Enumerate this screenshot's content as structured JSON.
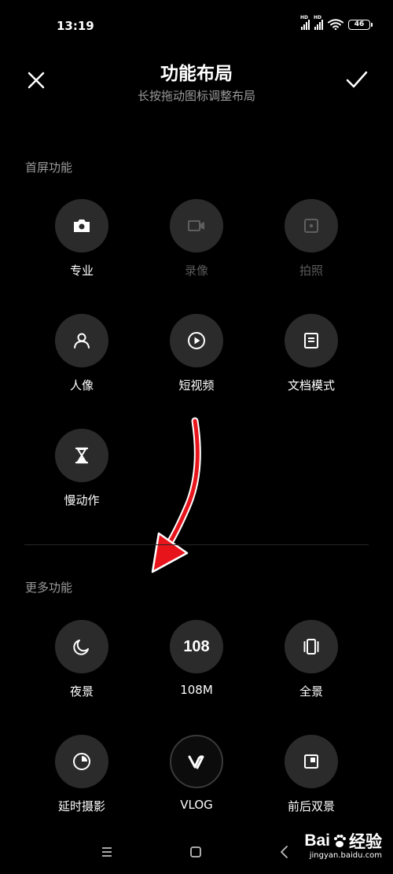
{
  "status_bar": {
    "time": "13:19",
    "signal1_label": "HD",
    "signal2_label": "HD",
    "battery": "46"
  },
  "header": {
    "title": "功能布局",
    "subtitle": "长按拖动图标调整布局",
    "close_icon": "close-icon",
    "confirm_icon": "check-icon"
  },
  "home_section": {
    "label": "首屏功能",
    "items": [
      {
        "label": "专业",
        "icon": "camera-icon",
        "enabled": true
      },
      {
        "label": "录像",
        "icon": "video-camera-icon",
        "enabled": false
      },
      {
        "label": "拍照",
        "icon": "shutter-icon",
        "enabled": false
      },
      {
        "label": "人像",
        "icon": "person-icon",
        "enabled": true
      },
      {
        "label": "短视频",
        "icon": "play-icon",
        "enabled": true
      },
      {
        "label": "文档模式",
        "icon": "document-icon",
        "enabled": true
      },
      {
        "label": "慢动作",
        "icon": "hourglass-icon",
        "enabled": true
      }
    ]
  },
  "more_section": {
    "label": "更多功能",
    "items": [
      {
        "label": "夜景",
        "icon": "moon-icon"
      },
      {
        "label": "108M",
        "icon_text": "108"
      },
      {
        "label": "全景",
        "icon": "panorama-icon"
      },
      {
        "label": "延时摄影",
        "icon": "timer-icon"
      },
      {
        "label": "VLOG",
        "icon": "vlog-icon"
      },
      {
        "label": "前后双景",
        "icon": "dual-view-icon"
      }
    ]
  },
  "annotation": {
    "icon": "red-arrow-icon",
    "color": "#e8141c"
  },
  "nav_bar": {
    "menu_icon": "menu-icon",
    "home_icon": "home-icon",
    "back_icon": "back-icon"
  },
  "watermark": {
    "logo_left": "Bai",
    "logo_right": "经验",
    "url": "jingyan.baidu.com"
  }
}
